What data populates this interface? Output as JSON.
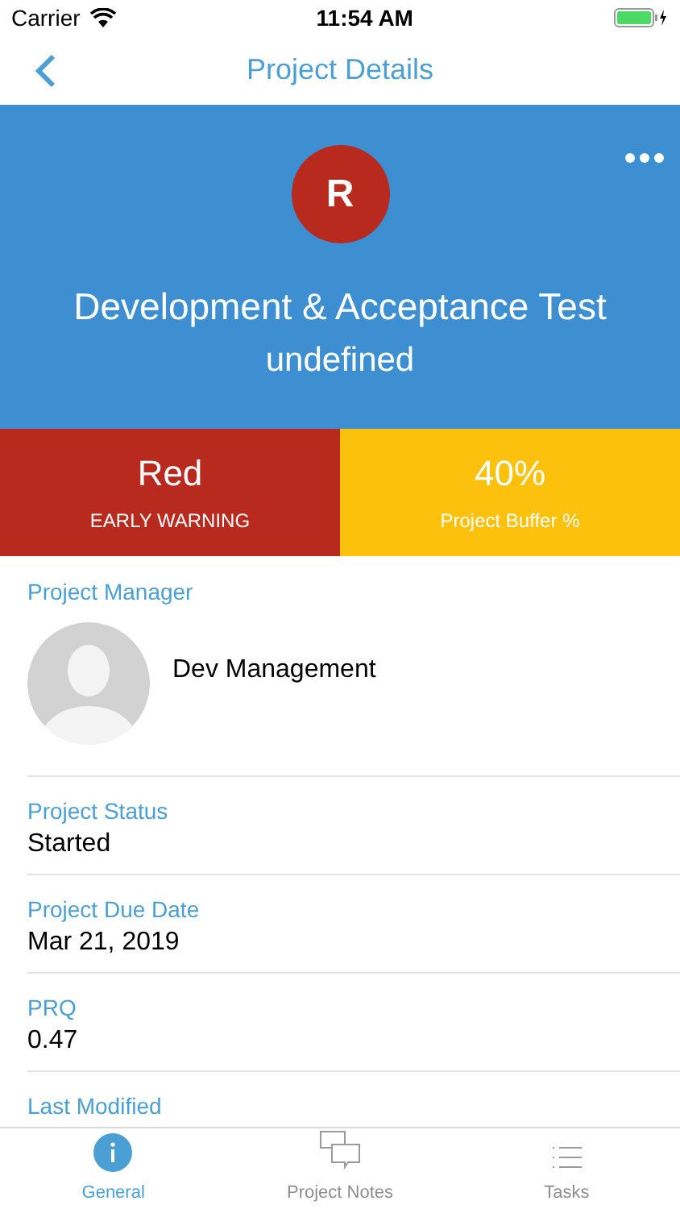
{
  "status_bar": {
    "carrier": "Carrier",
    "time": "11:54 AM"
  },
  "nav": {
    "title": "Project Details"
  },
  "header": {
    "initial": "R",
    "title": "Development & Acceptance Test",
    "subtitle": "undefined"
  },
  "stats": [
    {
      "value": "Red",
      "caption": "EARLY WARNING",
      "color": "#b82a1d"
    },
    {
      "value": "40%",
      "caption": "Project Buffer %",
      "color": "#fcc10c"
    }
  ],
  "manager": {
    "label": "Project Manager",
    "name": "Dev Management"
  },
  "fields": [
    {
      "label": "Project Status",
      "value": "Started"
    },
    {
      "label": "Project Due Date",
      "value": "Mar 21, 2019"
    },
    {
      "label": "PRQ",
      "value": "0.47"
    },
    {
      "label": "Last Modified"
    }
  ],
  "tabs": [
    {
      "label": "General",
      "kind": "info",
      "selected": true
    },
    {
      "label": "Project Notes",
      "kind": "notes",
      "selected": false
    },
    {
      "label": "Tasks",
      "kind": "list",
      "selected": false
    }
  ]
}
